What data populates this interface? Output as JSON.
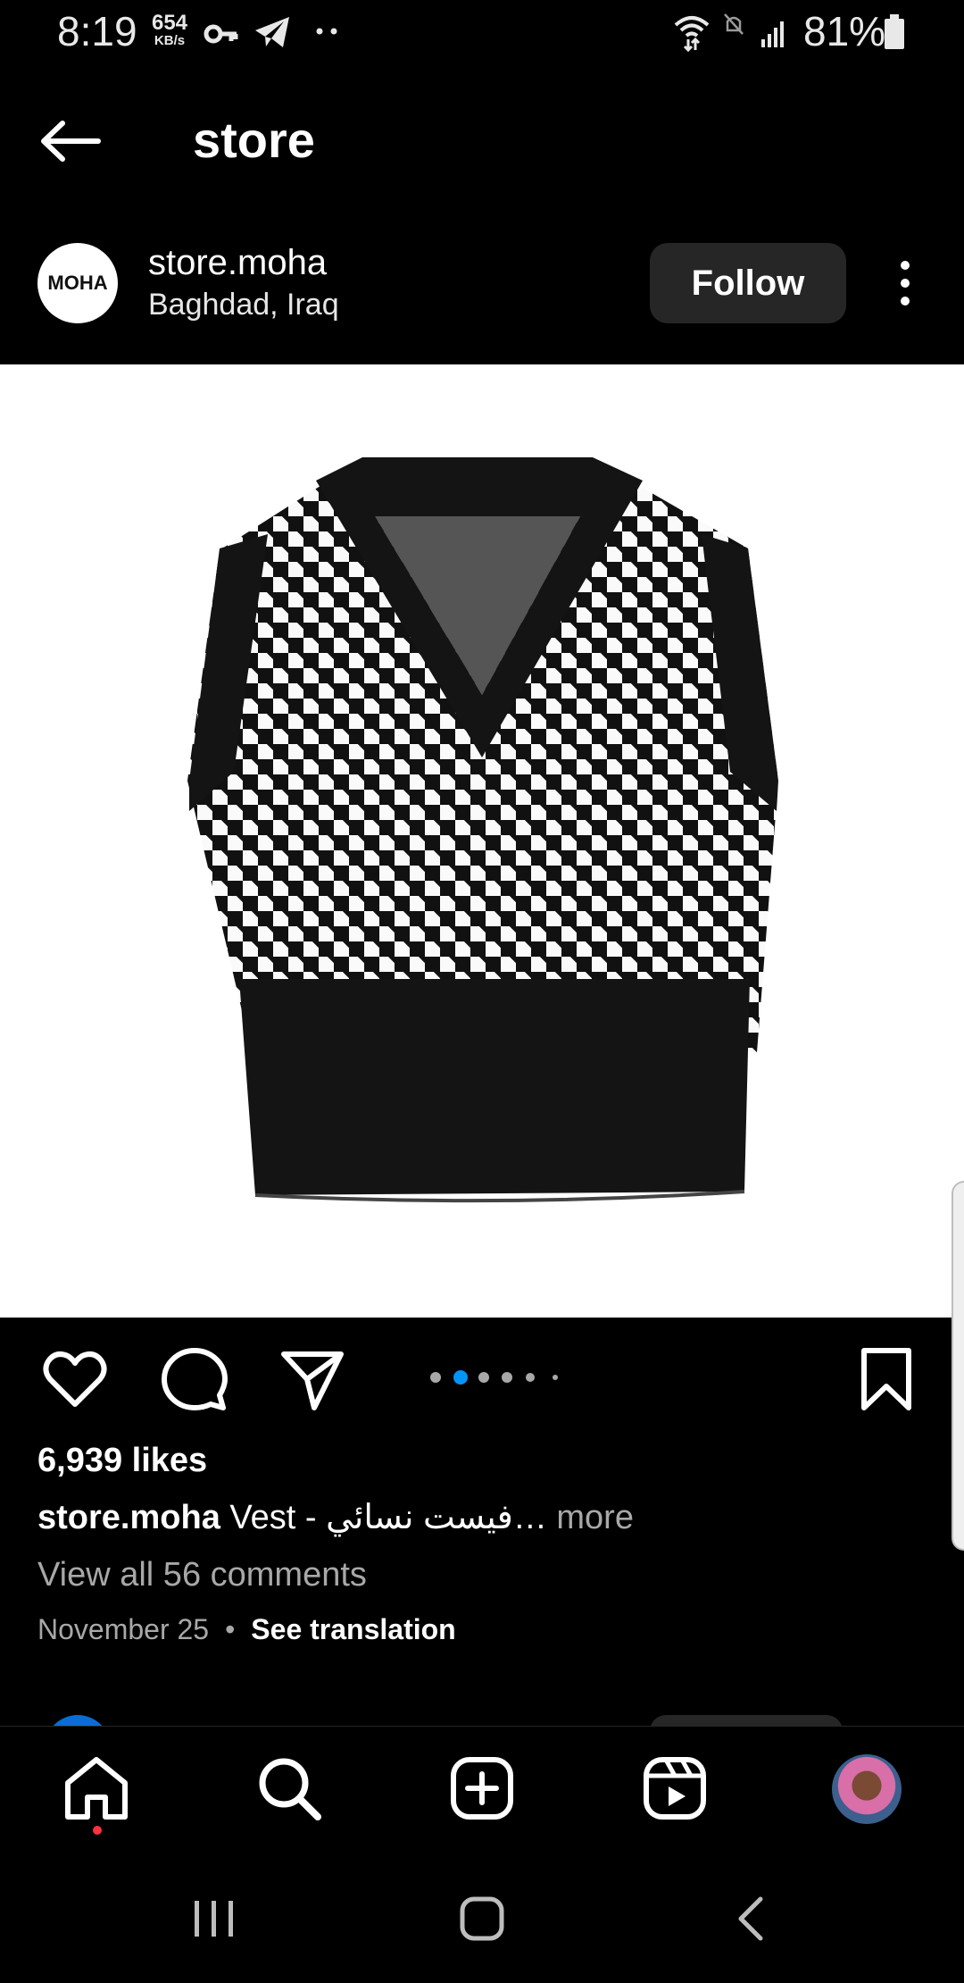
{
  "status_bar": {
    "time": "8:19",
    "net_speed_value": "654",
    "net_speed_unit": "KB/s",
    "battery": "81%",
    "icons": [
      "key-icon",
      "telegram-icon",
      "more-dots-icon",
      "wifi-icon",
      "mute-icon",
      "signal-icon",
      "battery-icon"
    ]
  },
  "header": {
    "back_icon": "back-arrow-icon",
    "title": "store"
  },
  "post": {
    "avatar_text": "MOHA",
    "username": "store.moha",
    "location": "Baghdad, Iraq",
    "follow_label": "Follow",
    "image_alt": "black and white houndstooth knit vest",
    "carousel_total": 6,
    "carousel_active_index": 1,
    "likes": "6,939 likes",
    "caption_user": "store.moha",
    "caption_text": "Vest - فيست نسائي…",
    "caption_more": "more",
    "view_comments": "View all 56 comments",
    "date": "November 25",
    "date_separator": "•",
    "see_translation": "See translation"
  },
  "actions": [
    "heart-icon",
    "comment-icon",
    "share-icon",
    "bookmark-icon"
  ],
  "bottom_nav": [
    "home-icon",
    "search-icon",
    "create-icon",
    "reels-icon",
    "profile-avatar"
  ],
  "system_nav": [
    "recents-icon",
    "home-button-icon",
    "back-icon"
  ],
  "colors": {
    "background": "#000000",
    "button_bg": "#262626",
    "muted_text": "#a8a8a8",
    "active_dot": "#0095f6",
    "notification_dot": "#ff3040"
  }
}
